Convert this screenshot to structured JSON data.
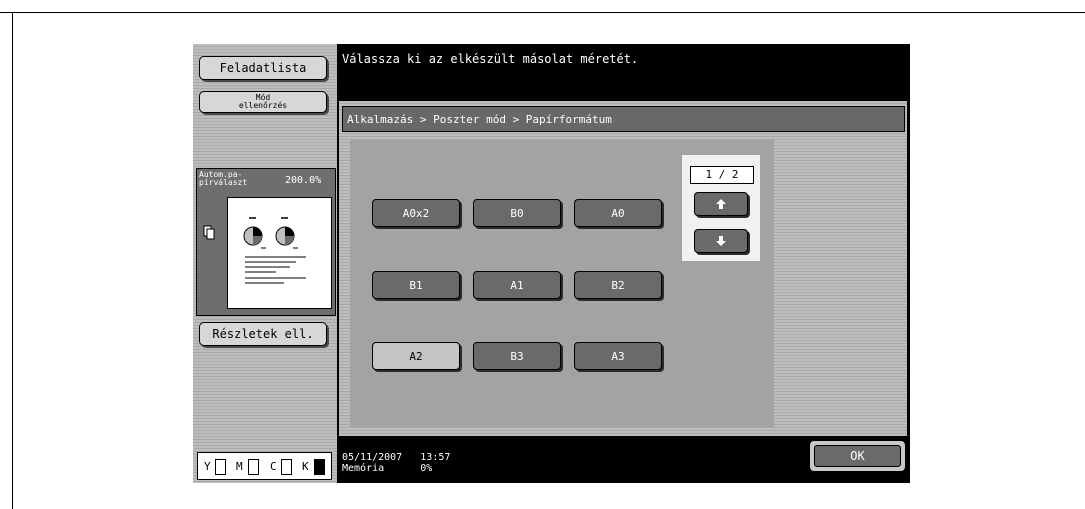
{
  "sidebar": {
    "job_list": "Feladatlista",
    "mode_check": "Mód\nellenőrzés",
    "auto_label": "Autom.pa-\npírválaszt",
    "auto_zoom": "200.0%",
    "details_check": "Részletek ell.",
    "toner": [
      "Y",
      "M",
      "C",
      "K"
    ]
  },
  "message": "Válassza ki az elkészült másolat méretét.",
  "breadcrumb": "Alkalmazás > Poszter mód > Papírformátum",
  "paper_sizes": {
    "row1": [
      "A0x2",
      "B0",
      "A0"
    ],
    "row2": [
      "B1",
      "A1",
      "B2"
    ],
    "row3": [
      "A2",
      "B3",
      "A3"
    ],
    "selected": "A2"
  },
  "pager": {
    "page": "1 / 2"
  },
  "status": {
    "date": "05/11/2007",
    "time": "13:57",
    "memory_label": "Memória",
    "memory_value": "0%"
  },
  "ok_button": "OK",
  "colors": {
    "screen_bg": "#000000",
    "button_dark": "#6a6a6a",
    "button_selected": "#c4c4c4"
  }
}
